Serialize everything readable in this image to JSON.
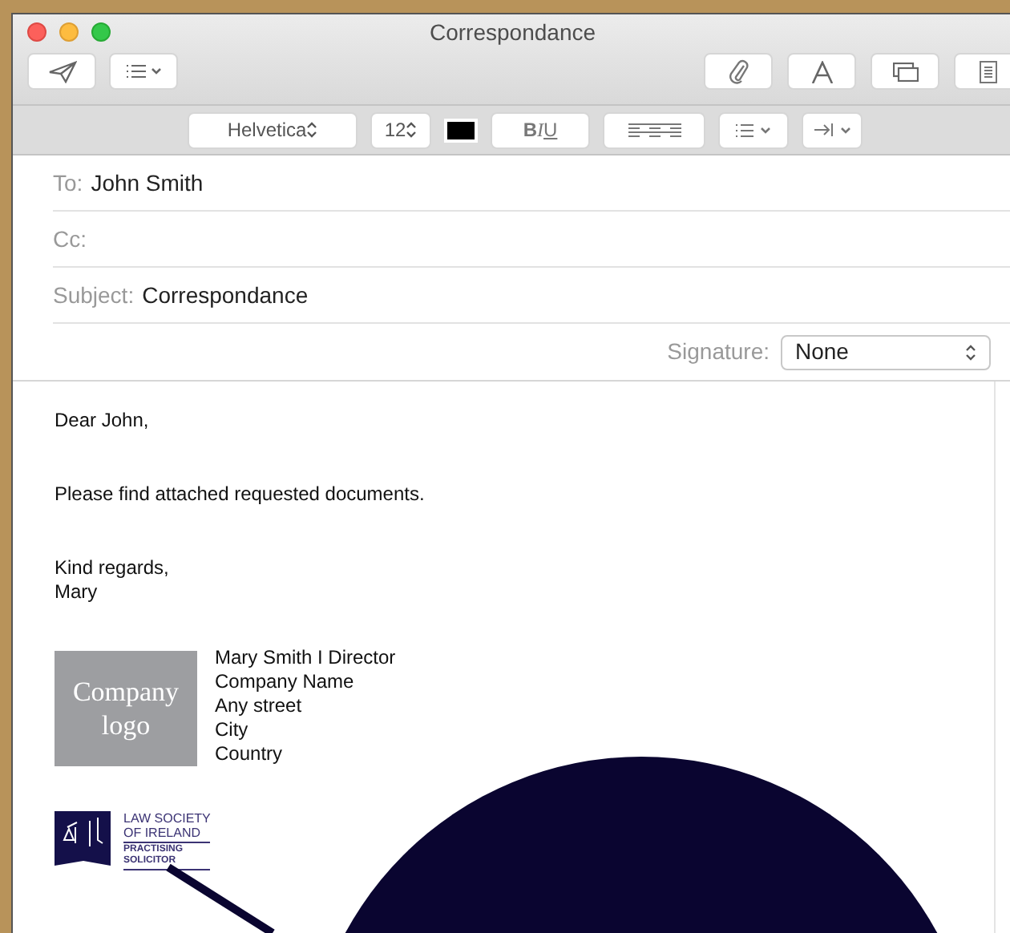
{
  "window": {
    "title": "Correspondance"
  },
  "format_bar": {
    "font": "Helvetica",
    "size": "12",
    "style_buttons": [
      "B",
      "I",
      "U"
    ]
  },
  "header_fields": [
    {
      "label": "To:",
      "value": "John Smith"
    },
    {
      "label": "Cc:"
    },
    {
      "label": "Subject:",
      "value": "Correspondance"
    }
  ],
  "signature": {
    "label": "Signature:",
    "value": "None"
  },
  "body": {
    "greeting": "Dear John,",
    "message": "Please find attached requested documents.",
    "closing": [
      "Kind regards,",
      "Mary"
    ]
  },
  "email_signature": {
    "logo_text": [
      "Company",
      "logo"
    ],
    "lines": [
      "Mary Smith I Director",
      "Company Name",
      "Any street",
      "City",
      "Country"
    ]
  },
  "badge": {
    "lines": [
      "LAW SOCIETY",
      "OF IRELAND"
    ],
    "sub_lines": [
      "PRACTISING",
      "SOLICITOR"
    ]
  }
}
